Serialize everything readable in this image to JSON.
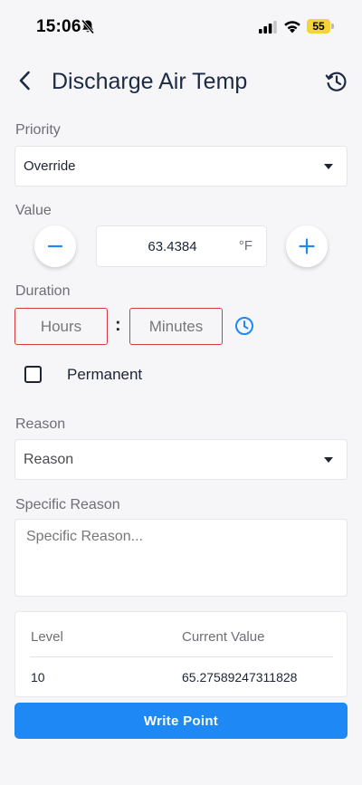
{
  "status_bar": {
    "time": "15:06",
    "battery": "55",
    "icons": [
      "bell-slash-icon",
      "cellular-signal-icon",
      "wifi-icon",
      "battery-icon"
    ],
    "battery_color": "#f5d33a"
  },
  "header": {
    "title": "Discharge Air Temp",
    "back_icon": "chevron-left-icon",
    "history_icon": "history-clock-icon"
  },
  "priority": {
    "label": "Priority",
    "selected": "Override"
  },
  "value": {
    "label": "Value",
    "current": "63.4384",
    "unit": "°F",
    "decrement_symbol": "minus-icon",
    "increment_symbol": "plus-icon"
  },
  "duration": {
    "label": "Duration",
    "hours_placeholder": "Hours",
    "minutes_placeholder": "Minutes",
    "separator": ":",
    "clock_icon": "clock-icon",
    "invalid_border_color": "#d73a3a"
  },
  "permanent": {
    "label": "Permanent",
    "checked": false
  },
  "reason": {
    "label": "Reason",
    "selected": "Reason"
  },
  "specific_reason": {
    "label": "Specific Reason",
    "placeholder": "Specific Reason..."
  },
  "levels_table": {
    "columns": [
      "Level",
      "Current Value"
    ],
    "rows": [
      {
        "level": "10",
        "current_value": "65.27589247311828"
      }
    ]
  },
  "actions": {
    "write_label": "Write Point",
    "accent_color": "#1e88f4"
  }
}
